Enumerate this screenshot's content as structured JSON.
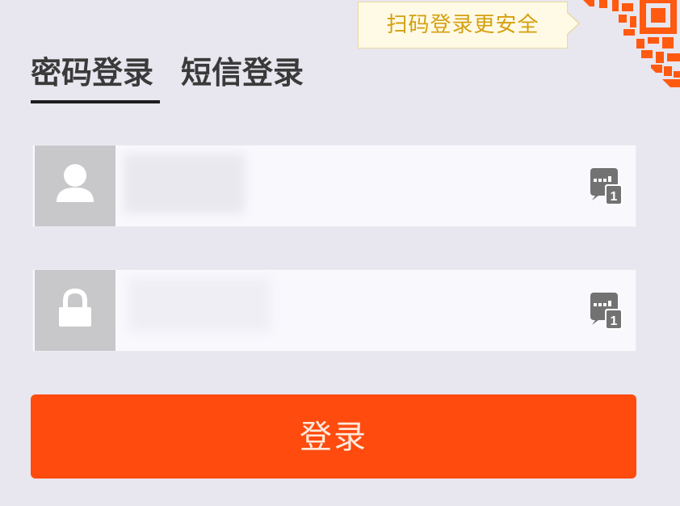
{
  "qr_tip": {
    "text": "扫码登录更安全"
  },
  "tabs": [
    {
      "label": "密码登录",
      "active": true
    },
    {
      "label": "短信登录",
      "active": false
    }
  ],
  "fields": {
    "username": {
      "value": "",
      "icon": "user-icon"
    },
    "password": {
      "value": "",
      "icon": "lock-icon"
    }
  },
  "keyboard_icon": "keyboard-icon",
  "login_button": {
    "label": "登录"
  },
  "colors": {
    "accent": "#ff4b0e",
    "tip_background": "#fffae5",
    "tip_text": "#d4a010",
    "qr": "#ff5a10",
    "icon_box": "#c8c8ca",
    "page_background": "#e8e6ee"
  }
}
